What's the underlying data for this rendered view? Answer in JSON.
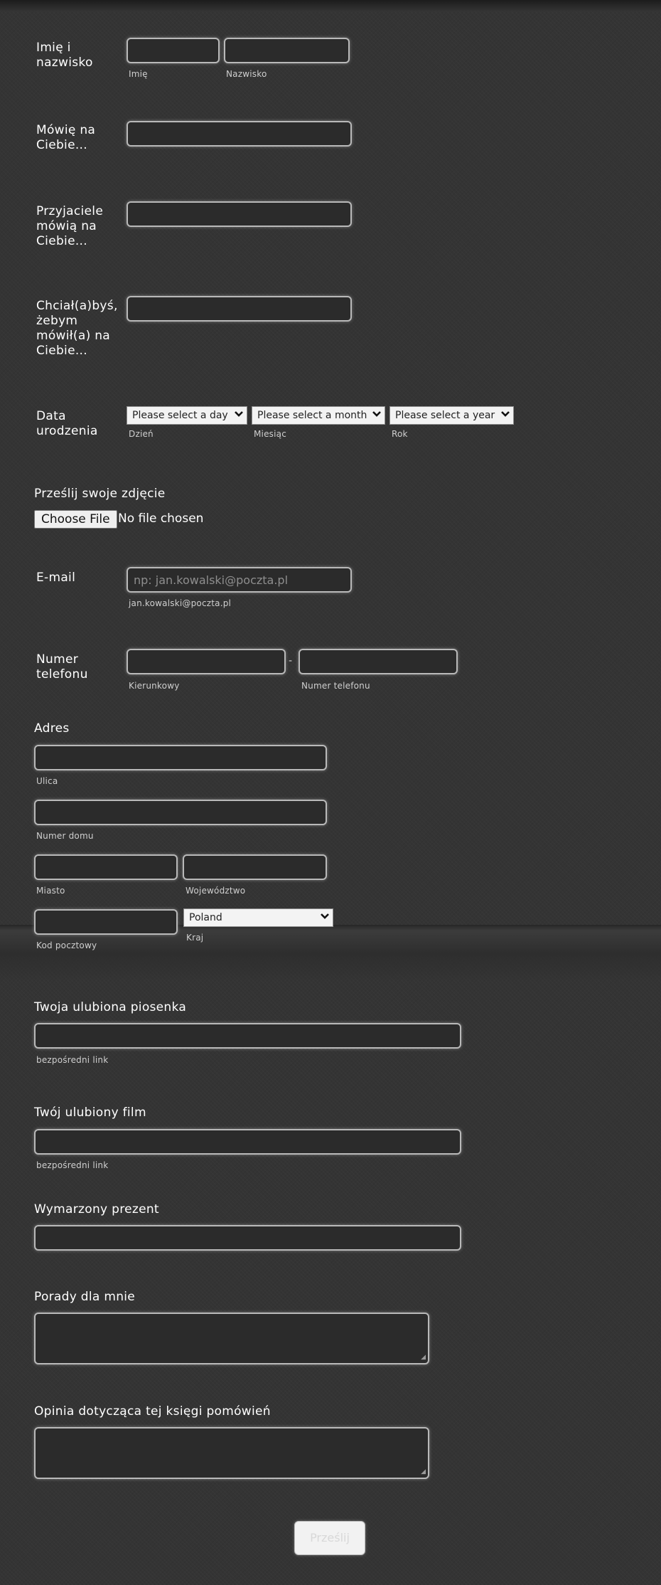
{
  "fields": {
    "name": {
      "label": "Imię i nazwisko",
      "first_sub": "Imię",
      "last_sub": "Nazwisko"
    },
    "self": {
      "label": "Mówię na Ciebie..."
    },
    "friends": {
      "label": "Przyjaciele mówią na Ciebie..."
    },
    "wish": {
      "label": "Chciał(a)byś, żebym mówił(a) na Ciebie..."
    },
    "birth": {
      "label": "Data urodzenia",
      "day": {
        "value": "Please select a day",
        "sub": "Dzień"
      },
      "month": {
        "value": "Please select a month",
        "sub": "Miesiąc"
      },
      "year": {
        "value": "Please select a year",
        "sub": "Rok"
      }
    },
    "photo": {
      "label": "Prześlij swoje zdjęcie",
      "button": "Choose File",
      "status": "No file chosen"
    },
    "email": {
      "label": "E-mail",
      "placeholder": "np: jan.kowalski@poczta.pl",
      "sub": "jan.kowalski@poczta.pl"
    },
    "phone": {
      "label": "Numer telefonu",
      "separator": "-",
      "area_sub": "Kierunkowy",
      "number_sub": "Numer telefonu"
    },
    "address": {
      "label": "Adres",
      "street_sub": "Ulica",
      "house_sub": "Numer domu",
      "city_sub": "Miasto",
      "region_sub": "Województwo",
      "zip_sub": "Kod pocztowy",
      "country_value": "Poland",
      "country_sub": "Kraj"
    },
    "song": {
      "label": "Twoja ulubiona piosenka",
      "sub": "bezpośredni link"
    },
    "film": {
      "label": "Twój ulubiony film",
      "sub": "bezpośredni link"
    },
    "gift": {
      "label": "Wymarzony prezent"
    },
    "advice": {
      "label": "Porady dla mnie"
    },
    "opinion": {
      "label": "Opinia dotycząca tej księgi pomówień"
    }
  },
  "submit": {
    "label": "Prześlij"
  },
  "icons": {
    "select_arrow": "chevron-down-icon",
    "resize_grip": "resize-grip-icon"
  }
}
